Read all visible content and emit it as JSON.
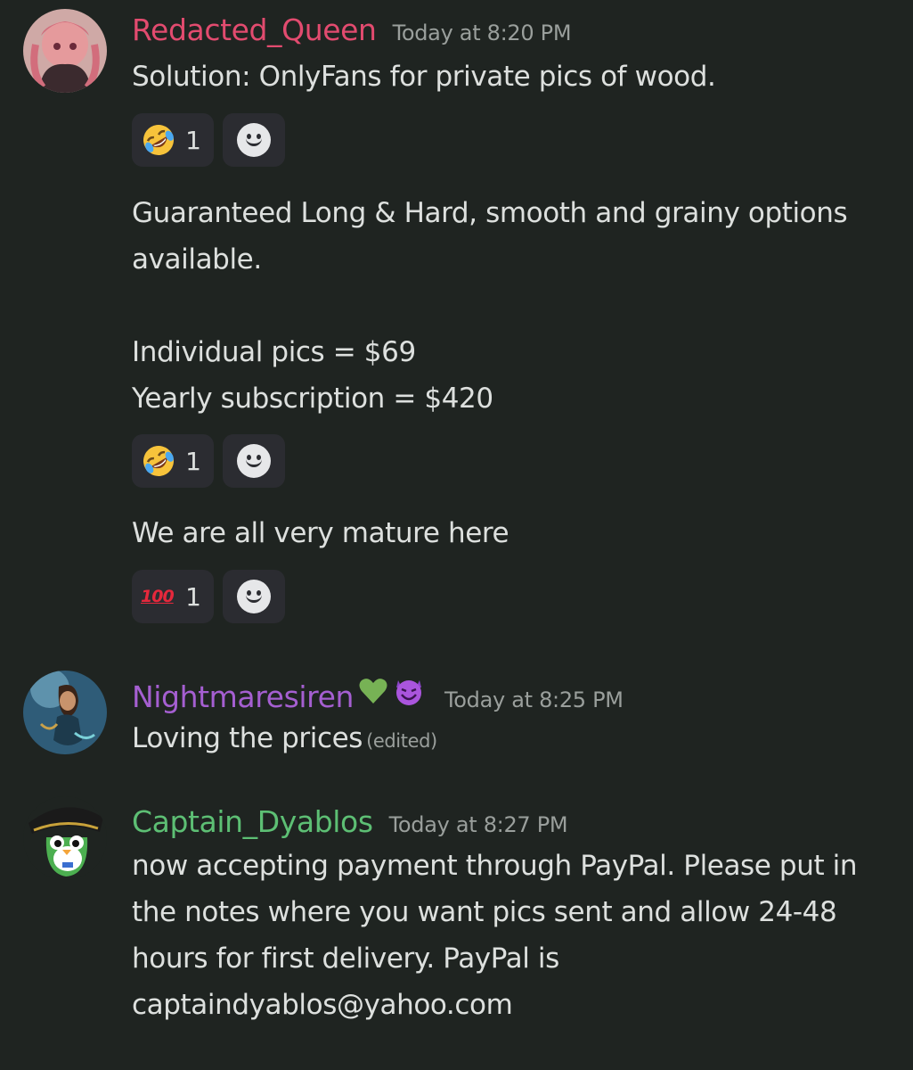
{
  "messages": [
    {
      "username": "Redacted_Queen",
      "username_color": "#e24b6f",
      "timestamp": "Today at 8:20 PM",
      "lines": [
        "Solution: OnlyFans for private pics of wood."
      ]
    },
    {
      "lines": [
        "Guaranteed Long & Hard, smooth and grainy options",
        "available.",
        "",
        "Individual pics = $69",
        "Yearly subscription = $420"
      ]
    },
    {
      "lines": [
        "We are all very mature here"
      ]
    },
    {
      "username": "Nightmaresiren",
      "username_color": "#a55fd1",
      "badges": [
        "green-heart",
        "smiling-imp"
      ],
      "timestamp": "Today at 8:25 PM",
      "lines": [
        "Loving the prices"
      ],
      "edited": "(edited)"
    },
    {
      "username": "Captain_Dyablos",
      "username_color": "#5dbf74",
      "timestamp": "Today at 8:27 PM",
      "lines": [
        "now accepting payment through PayPal. Please put in",
        "the notes where you want pics sent and allow 24-48",
        "hours for first delivery. PayPal is",
        "captaindyablos@yahoo.com"
      ]
    }
  ],
  "reactions": [
    {
      "emoji": "rolling-on-floor-laughing",
      "count": "1"
    },
    {
      "emoji": "rolling-on-floor-laughing",
      "count": "1"
    },
    {
      "emoji": "hundred-points",
      "glyph": "100",
      "count": "1"
    }
  ],
  "add_reaction_icon": "add-reaction-smiley-icon",
  "colors": {
    "background": "#1f2421",
    "reaction_bg": "#2b2c31",
    "timestamp": "#9a9f9c",
    "text": "#dde0de"
  }
}
